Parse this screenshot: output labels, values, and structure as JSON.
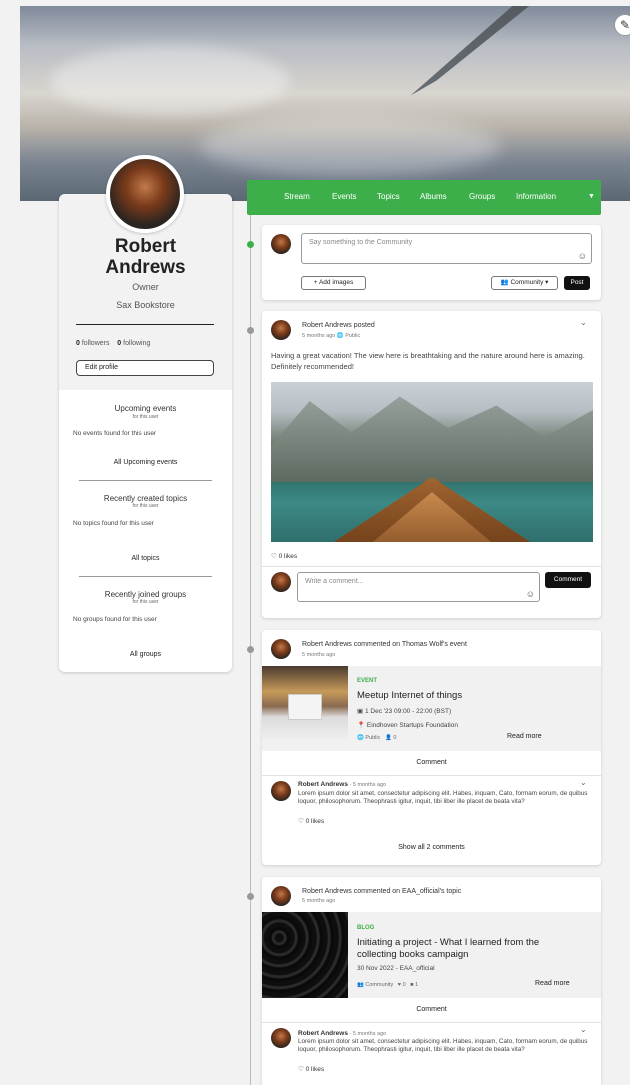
{
  "profile": {
    "first_name": "Robert",
    "last_name": "Andrews",
    "role": "Owner",
    "organization": "Sax Bookstore",
    "followers_count": "0",
    "followers_label": "followers",
    "following_count": "0",
    "following_label": "following",
    "edit_label": "Edit profile"
  },
  "sidebar": {
    "events_title": "Upcoming events",
    "events_sub": "for this user",
    "events_empty": "No events found for this user",
    "events_link": "All Upcoming events",
    "topics_title": "Recently created topics",
    "topics_sub": "for this user",
    "topics_empty": "No topics found for this user",
    "topics_link": "All topics",
    "groups_title": "Recently joined groups",
    "groups_sub": "for this user",
    "groups_empty": "No groups found for this user",
    "groups_link": "All groups"
  },
  "nav": {
    "items": [
      "Stream",
      "Events",
      "Topics",
      "Albums",
      "Groups",
      "Information"
    ]
  },
  "composer": {
    "placeholder": "Say something to the Community",
    "add_images": "+ Add images",
    "visibility": "Community",
    "post_label": "Post"
  },
  "post1": {
    "author": "Robert Andrews",
    "action": "posted",
    "time": "5 months ago",
    "visibility": "Public",
    "text": "Having a great vacation! The view here is breathtaking and the nature around here is amazing. Definitely recommended!",
    "likes": "0 likes",
    "comment_placeholder": "Write a comment...",
    "comment_button": "Comment"
  },
  "post2": {
    "author": "Robert Andrews",
    "action": "commented on Thomas Wolf's event",
    "time": "5 months ago",
    "tag": "EVENT",
    "title": "Meetup Internet of things",
    "date": "1 Dec '23 09:00 - 22:00 (BST)",
    "location": "Eindhoven Startups Foundation",
    "visibility": "Public",
    "attendees": "0",
    "read_more": "Read more",
    "comment_label": "Comment",
    "comment_author": "Robert Andrews",
    "comment_time": " - 5 months ago",
    "comment_text": "Lorem ipsum dolor sit amet, consectetur adipiscing elit. Habes, inquam, Cato, formam eorum, de quibus loquor, philosophorum. Theophrasti igitur, inquit, tibi liber ille placet de beata vita?",
    "comment_likes": "0 likes",
    "show_all": "Show all 2 comments"
  },
  "post3": {
    "author": "Robert Andrews",
    "action": "commented on EAA_official's topic",
    "time": "5 months ago",
    "tag": "BLOG",
    "title": "Initiating a project - What I learned from the collecting books campaign",
    "date_author": "30 Nov 2022 - EAA_official",
    "visibility": "Community",
    "likes": "0",
    "comments": "1",
    "read_more": "Read more",
    "comment_label": "Comment",
    "comment_author": "Robert Andrews",
    "comment_time": " - 5 months ago",
    "comment_text": "Lorem ipsum dolor sit amet, consectetur adipiscing elit. Habes, inquam, Cato, formam eorum, de quibus loquor, philosophorum. Theophrasti igitur, inquit, tibi liber ille placet de beata vita?",
    "comment_likes": "0 likes"
  },
  "colors": {
    "accent": "#3daf4a",
    "background": "#f2f2f2"
  }
}
